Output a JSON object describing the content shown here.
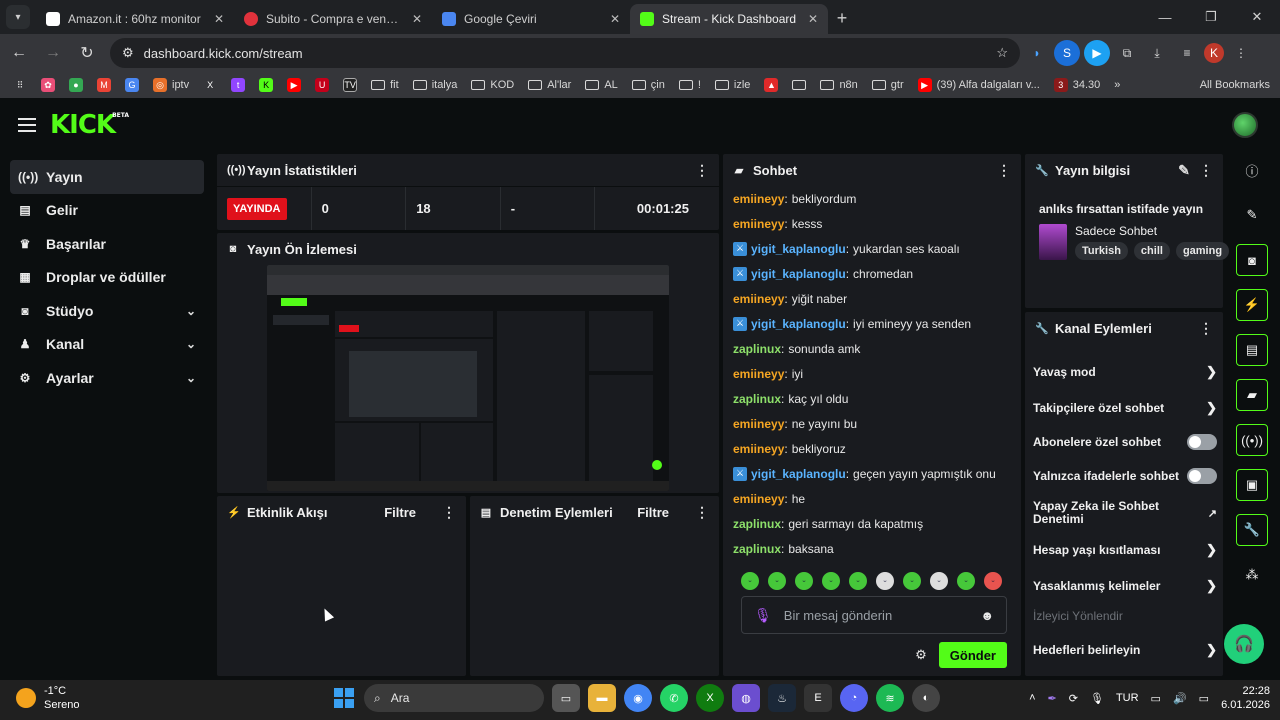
{
  "browser": {
    "tabs": [
      {
        "title": "Amazon.it : 60hz monitor",
        "favicon_color": "#ffffff"
      },
      {
        "title": "Subito - Compra e vendi gratis",
        "favicon_color": "#e0323c"
      },
      {
        "title": "Google Çeviri",
        "favicon_color": "#4a86f0"
      },
      {
        "title": "Stream - Kick Dashboard",
        "favicon_color": "#53fc18"
      }
    ],
    "url": "dashboard.kick.com/stream",
    "profile_initial": "K",
    "bookmarks": [
      "iptv",
      "fit",
      "italya",
      "KOD",
      "Al'lar",
      "AL",
      "çin",
      "!",
      "izle",
      "n8n",
      "gtr",
      "(39) Alfa dalgaları v...",
      "34.30"
    ],
    "all_bookmarks": "All Bookmarks"
  },
  "logo": {
    "text": "KICK",
    "beta": "BETA"
  },
  "sidebar": {
    "items": [
      {
        "label": "Yayın",
        "icon": "broadcast-icon"
      },
      {
        "label": "Gelir",
        "icon": "chart-icon"
      },
      {
        "label": "Başarılar",
        "icon": "trophy-icon"
      },
      {
        "label": "Droplar ve ödüller",
        "icon": "gift-icon"
      },
      {
        "label": "Stüdyo",
        "icon": "studio-icon"
      },
      {
        "label": "Kanal",
        "icon": "users-icon"
      },
      {
        "label": "Ayarlar",
        "icon": "gear-icon"
      }
    ]
  },
  "stats": {
    "title": "Yayın İstatistikleri",
    "live": "YAYINDA",
    "values": [
      "0",
      "18",
      "-",
      "00:01:25"
    ]
  },
  "preview": {
    "title": "Yayın Ön İzlemesi"
  },
  "activity": {
    "title": "Etkinlik Akışı",
    "filter": "Filtre"
  },
  "moderation": {
    "title": "Denetim Eylemleri",
    "filter": "Filtre"
  },
  "chat": {
    "title": "Sohbet",
    "messages": [
      {
        "user": "emiineyy",
        "text": "bekliyordum",
        "color": "#f5a623",
        "badge": false
      },
      {
        "user": "emiineyy",
        "text": "kesss",
        "color": "#f5a623",
        "badge": false
      },
      {
        "user": "yigit_kaplanoglu",
        "text": "yukardan ses kaoalı",
        "color": "#5ab4ff",
        "badge": true
      },
      {
        "user": "yigit_kaplanoglu",
        "text": "chromedan",
        "color": "#5ab4ff",
        "badge": true
      },
      {
        "user": "emiineyy",
        "text": "yiğit naber",
        "color": "#f5a623",
        "badge": false
      },
      {
        "user": "yigit_kaplanoglu",
        "text": "iyi emineyy ya senden",
        "color": "#5ab4ff",
        "badge": true
      },
      {
        "user": "zaplinux",
        "text": "sonunda amk",
        "color": "#8de06a",
        "badge": false
      },
      {
        "user": "emiineyy",
        "text": "iyi",
        "color": "#f5a623",
        "badge": false
      },
      {
        "user": "zaplinux",
        "text": "kaç yıl oldu",
        "color": "#8de06a",
        "badge": false
      },
      {
        "user": "emiineyy",
        "text": "ne yayını bu",
        "color": "#f5a623",
        "badge": false
      },
      {
        "user": "emiineyy",
        "text": "bekliyoruz",
        "color": "#f5a623",
        "badge": false
      },
      {
        "user": "yigit_kaplanoglu",
        "text": "geçen yayın yapmıştık onu",
        "color": "#5ab4ff",
        "badge": true
      },
      {
        "user": "emiineyy",
        "text": "he",
        "color": "#f5a623",
        "badge": false
      },
      {
        "user": "zaplinux",
        "text": "geri sarmayı da kapatmış",
        "color": "#8de06a",
        "badge": false
      },
      {
        "user": "zaplinux",
        "text": "baksana",
        "color": "#8de06a",
        "badge": false
      }
    ],
    "placeholder": "Bir mesaj gönderin",
    "send": "Gönder"
  },
  "info": {
    "title": "Yayın bilgisi",
    "stream_title": "anlıks fırsattan istifade yayın",
    "category": "Sadece Sohbet",
    "tags": [
      "Turkish",
      "chill",
      "gaming"
    ]
  },
  "channel_actions": {
    "title": "Kanal Eylemleri",
    "items": [
      {
        "label": "Yavaş mod",
        "kind": "arrow"
      },
      {
        "label": "Takipçilere özel sohbet",
        "kind": "arrow"
      },
      {
        "label": "Abonelere özel sohbet",
        "kind": "toggle"
      },
      {
        "label": "Yalnızca ifadelerle sohbet",
        "kind": "toggle"
      },
      {
        "label": "Yapay Zeka ile Sohbet Denetimi",
        "kind": "external"
      },
      {
        "label": "Hesap yaşı kısıtlaması",
        "kind": "arrow"
      },
      {
        "label": "Yasaklanmış kelimeler",
        "kind": "arrow"
      },
      {
        "label": "İzleyici Yönlendir",
        "kind": "disabled"
      },
      {
        "label": "Hedefleri belirleyin",
        "kind": "arrow"
      }
    ]
  },
  "taskbar": {
    "temp": "-1°C",
    "condition": "Sereno",
    "search": "Ara",
    "lang": "TUR",
    "time": "22:28",
    "date": "6.01.2026"
  }
}
